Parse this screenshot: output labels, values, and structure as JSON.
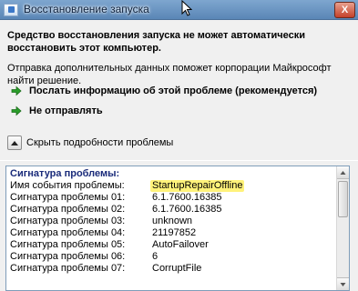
{
  "window": {
    "title": "Восстановление запуска",
    "close_label": "X"
  },
  "message": {
    "intro": "Средство восстановления запуска не может автоматически восстановить этот компьютер.",
    "info": "Отправка дополнительных данных поможет корпорации Майкрософт найти решение."
  },
  "options": [
    {
      "label": "Послать информацию об этой проблеме (рекомендуется)",
      "icon": "green-arrow-icon"
    },
    {
      "label": "Не отправлять",
      "icon": "green-arrow-icon"
    }
  ],
  "details_toggle": {
    "label": "Скрыть подробности проблемы",
    "icon": "chevron-up-icon"
  },
  "details": {
    "header": "Сигнатура проблемы:",
    "rows": [
      {
        "key": "Имя события проблемы:",
        "value": "StartupRepairOffline"
      },
      {
        "key": "Сигнатура проблемы 01:",
        "value": "6.1.7600.16385"
      },
      {
        "key": "Сигнатура проблемы 02:",
        "value": "6.1.7600.16385"
      },
      {
        "key": "Сигнатура проблемы 03:",
        "value": "unknown"
      },
      {
        "key": "Сигнатура проблемы 04:",
        "value": "21197852"
      },
      {
        "key": "Сигнатура проблемы 05:",
        "value": "AutoFailover"
      },
      {
        "key": "Сигнатура проблемы 06:",
        "value": "6"
      },
      {
        "key": "Сигнатура проблемы 07:",
        "value": "CorruptFile"
      }
    ]
  },
  "colors": {
    "highlight": "#fff27a",
    "arrow_green": "#2a9d2a",
    "header_blue": "#1a2b7a"
  }
}
